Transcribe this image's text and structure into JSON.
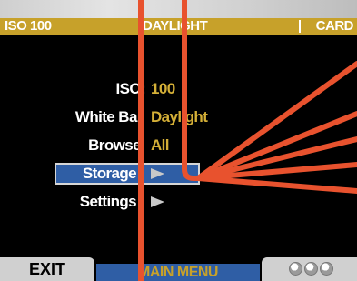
{
  "status_bar": {
    "iso": "ISO 100",
    "white_balance": "DAYLIGHT",
    "destination": "CARD"
  },
  "menu": {
    "items": [
      {
        "label": "ISO:",
        "value": "100"
      },
      {
        "label": "White Bal:",
        "value": "Daylight"
      },
      {
        "label": "Browse:",
        "value": "All"
      },
      {
        "label": "Storage",
        "value": ""
      },
      {
        "label": "Settings",
        "value": ""
      }
    ],
    "selected_index": 3
  },
  "bottom_bar": {
    "exit_label": "EXIT",
    "title": "MAIN MENU"
  },
  "icons": {
    "submenu_arrow": "play-triangle-icon",
    "page_dots": "three-dots-icon",
    "overlay": "red-callout-lines"
  },
  "colors": {
    "status_bar_bg": "#c7a12a",
    "screen_bg": "#000000",
    "value_text": "#d4af37",
    "selection_bg": "#2f5ea5",
    "callout_lines": "#e8522e"
  }
}
